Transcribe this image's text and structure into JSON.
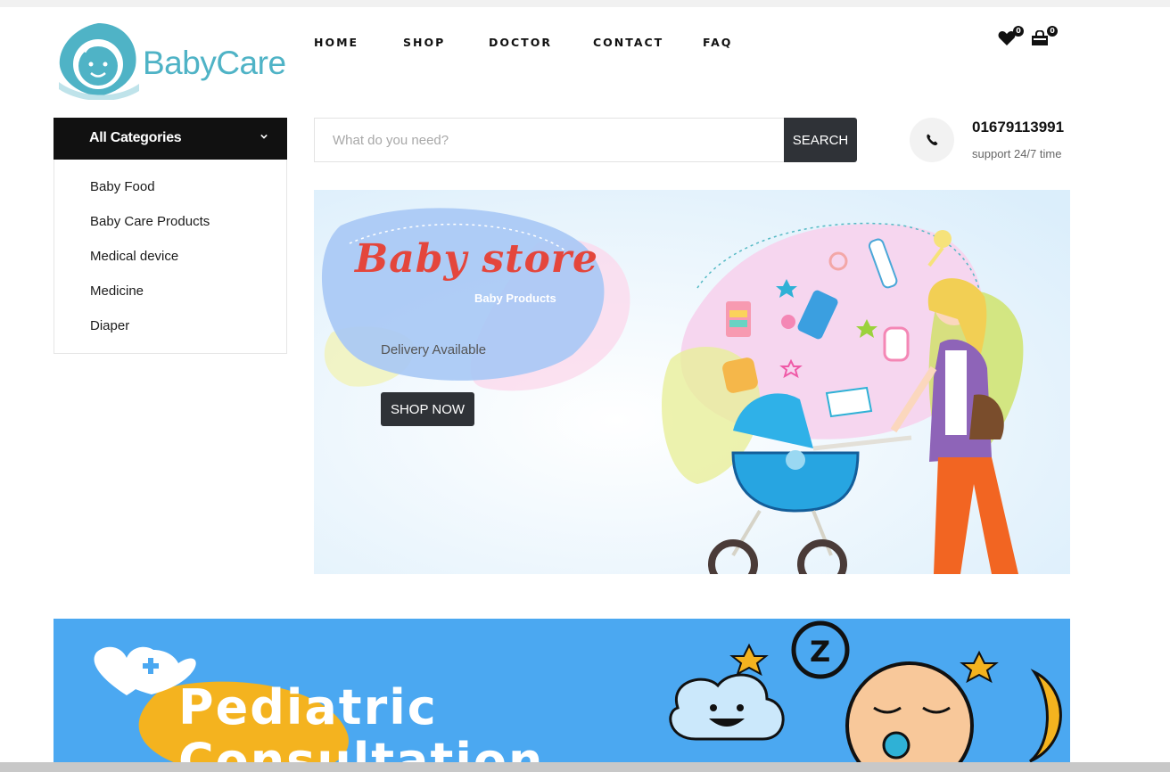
{
  "brand": {
    "name": "BabyCare",
    "primary_color": "#4fb3c6"
  },
  "nav": {
    "items": [
      {
        "label": "HOME"
      },
      {
        "label": "SHOP"
      },
      {
        "label": "DOCTOR"
      },
      {
        "label": "CONTACT"
      },
      {
        "label": "FAQ"
      }
    ]
  },
  "header": {
    "wishlist_count": "0",
    "cart_count": "0"
  },
  "categories": {
    "title": "All Categories",
    "items": [
      {
        "label": "Baby Food"
      },
      {
        "label": "Baby Care Products"
      },
      {
        "label": "Medical device"
      },
      {
        "label": "Medicine"
      },
      {
        "label": "Diaper"
      }
    ]
  },
  "search": {
    "placeholder": "What do you need?",
    "button_label": "SEARCH"
  },
  "contact": {
    "phone": "01679113991",
    "support_text": "support 24/7 time"
  },
  "hero": {
    "title": "Baby store",
    "subtitle": "Baby Products",
    "tagline": "Delivery Available",
    "button_label": "SHOP NOW"
  },
  "promo": {
    "title_line1": "Pediatric",
    "title_line2": "Consultation"
  },
  "colors": {
    "dark_button": "#2f3237",
    "category_header": "#111111",
    "banner_blue": "#4ba8f1"
  }
}
